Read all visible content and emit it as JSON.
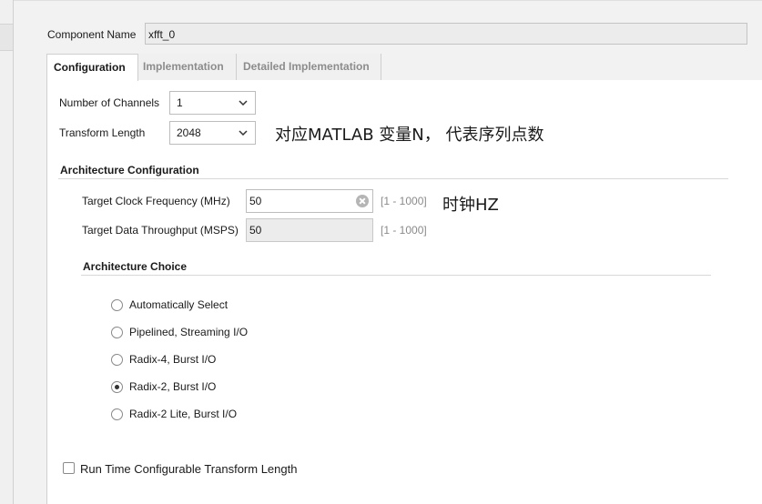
{
  "component_name": {
    "label": "Component Name",
    "value": "xfft_0"
  },
  "tabs": [
    {
      "label": "Configuration",
      "active": true
    },
    {
      "label": "Implementation",
      "active": false
    },
    {
      "label": "Detailed Implementation",
      "active": false
    }
  ],
  "channels": {
    "label": "Number of Channels",
    "value": "1"
  },
  "transform_length": {
    "label": "Transform Length",
    "value": "2048",
    "note": "对应MATLAB 变量N， 代表序列点数"
  },
  "architecture_configuration": {
    "title": "Architecture Configuration",
    "clock": {
      "label": "Target Clock Frequency (MHz)",
      "value": "50",
      "range": "[1 - 1000]",
      "note": "时钟HZ"
    },
    "throughput": {
      "label": "Target Data Throughput (MSPS)",
      "value": "50",
      "range": "[1 - 1000]"
    }
  },
  "architecture_choice": {
    "title": "Architecture Choice",
    "options": [
      {
        "label": "Automatically Select",
        "selected": false
      },
      {
        "label": "Pipelined, Streaming I/O",
        "selected": false
      },
      {
        "label": "Radix-4, Burst I/O",
        "selected": false
      },
      {
        "label": "Radix-2, Burst I/O",
        "selected": true
      },
      {
        "label": "Radix-2 Lite, Burst I/O",
        "selected": false
      }
    ]
  },
  "run_time_configurable": {
    "label": "Run Time Configurable Transform Length",
    "checked": false
  }
}
